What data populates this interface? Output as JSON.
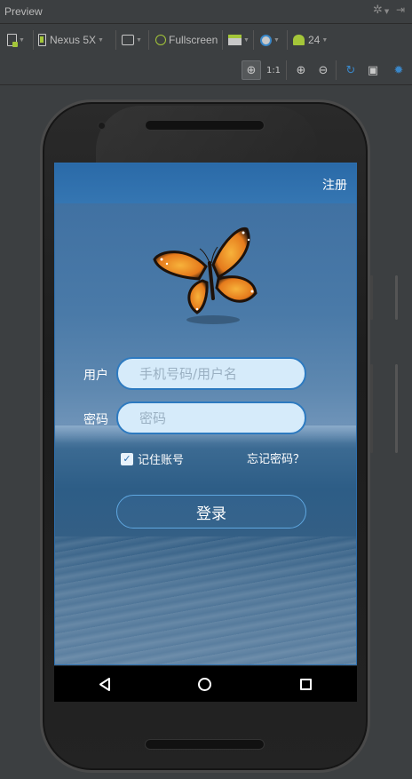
{
  "panel": {
    "title": "Preview"
  },
  "toolbar": {
    "device": "Nexus 5X",
    "fullscreen": "Fullscreen",
    "api_level": "24"
  },
  "zoom_tools": [
    "zoom-to-fit",
    "actual-size",
    "zoom-in",
    "zoom-out",
    "refresh",
    "screenshot",
    "settings"
  ],
  "app": {
    "register": "注册",
    "user_label": "用户",
    "user_placeholder": "手机号码/用户名",
    "password_label": "密码",
    "password_placeholder": "密码",
    "remember": "记住账号",
    "remember_checked": true,
    "forgot": "忘记密码？",
    "login": "登录"
  },
  "colors": {
    "ide_bg": "#3c3f41",
    "appbar": "#2a6aa8",
    "input_bg": "#d6ebfa",
    "accent": "#2d7ac0"
  }
}
